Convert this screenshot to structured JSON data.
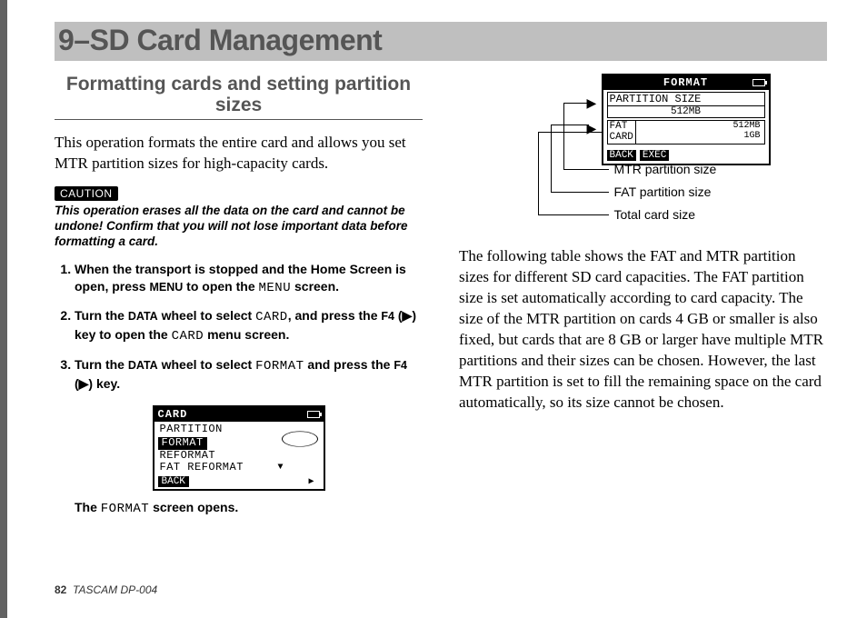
{
  "header": {
    "chapter": "9–SD Card Management"
  },
  "section": {
    "title": "Formatting cards and setting partition sizes"
  },
  "intro": "This operation formats the entire card and allows you set MTR partition sizes for high-capacity cards.",
  "caution": {
    "label": "CAUTION",
    "text": "This operation erases all the data on the card and cannot be undone! Confirm that you will not lose important data before formatting a card."
  },
  "steps": {
    "s1a": "When the transport is stopped and the Home Screen is open, press ",
    "s1b": " to open the ",
    "s1c": " screen.",
    "s2a": "Turn the ",
    "s2b": " wheel to select ",
    "s2c": ", and press the ",
    "s2d": " (▶) key to open the ",
    "s2e": " menu screen.",
    "s3a": "Turn the ",
    "s3b": " wheel to select ",
    "s3c": " and press the ",
    "s3d": " (▶) key.",
    "labels": {
      "menu_sc": "MENU",
      "data_sc": "DATA",
      "f4_sc": "F4",
      "menu_m": "MENU",
      "card_m": "CARD",
      "format_m": "FORMAT"
    }
  },
  "lcd1": {
    "title": "CARD",
    "items": [
      "PARTITION",
      "FORMAT",
      "REFORMAT",
      "FAT REFORMAT"
    ],
    "fn": "BACK"
  },
  "result": {
    "a": "The ",
    "b": " screen opens.",
    "m": "FORMAT"
  },
  "lcd2": {
    "title": "FORMAT",
    "partition_label": "PARTITION SIZE",
    "partition_value": "512MB",
    "fat_l1": "FAT",
    "fat_l2": "CARD",
    "fat_r1": "512MB",
    "fat_r2": "1GB",
    "fn1": "BACK",
    "fn2": "EXEC"
  },
  "callouts": {
    "mtr": "MTR partition size",
    "fat": "FAT partition size",
    "total": "Total card size"
  },
  "para": "The following table shows the FAT and MTR partition sizes for different SD card capacities. The FAT partition size is set automatically according to card capacity. The size of the MTR partition on cards 4 GB or smaller is also fixed, but cards that are 8 GB or larger have multiple MTR partitions and their sizes can be chosen. However, the last MTR partition is set to fill the remaining space on the card automatically, so its size cannot be chosen.",
  "footer": {
    "page": "82",
    "product": "TASCAM  DP-004"
  }
}
